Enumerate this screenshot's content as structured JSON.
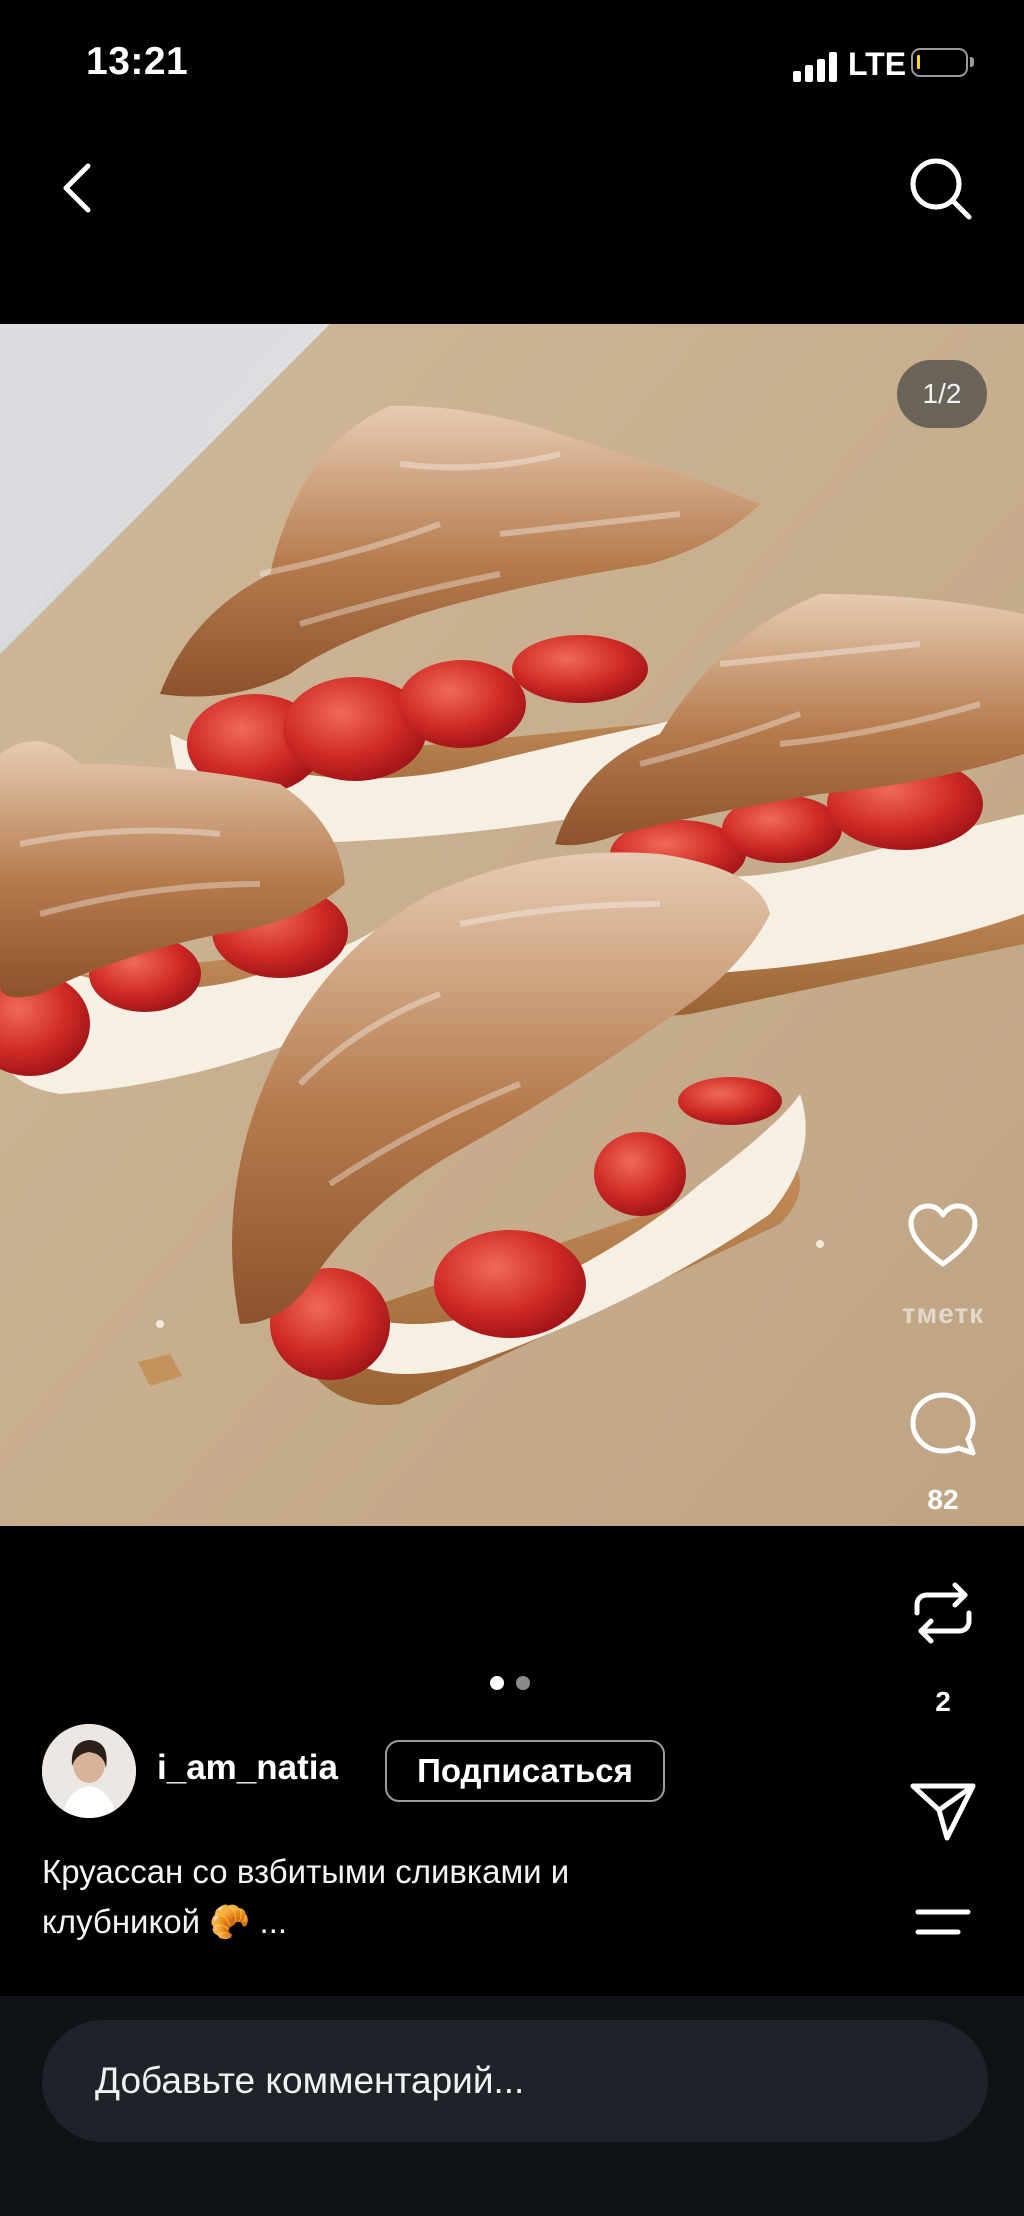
{
  "status_bar": {
    "time": "13:21",
    "network": "LTE",
    "battery_level_fraction": 0.05
  },
  "header": {
    "back_icon": "chevron-left-icon",
    "search_icon": "search-icon"
  },
  "post": {
    "image_counter": "1/2",
    "current_image": 1,
    "total_images": 2,
    "author": {
      "username": "i_am_natia",
      "follow_label": "Подписаться"
    },
    "caption": {
      "text": "Круассан со взбитыми сливками и клубникой",
      "emoji": "🥐",
      "more": "..."
    }
  },
  "actions": {
    "like_label": "тметк",
    "comment_count": "82",
    "repost_count": "2"
  },
  "comment": {
    "placeholder": "Добавьте комментарий..."
  },
  "colors": {
    "background": "#000000",
    "comment_bar": "#0f1317",
    "input_bg": "#1d2329",
    "battery_accent": "#ffd60a"
  }
}
